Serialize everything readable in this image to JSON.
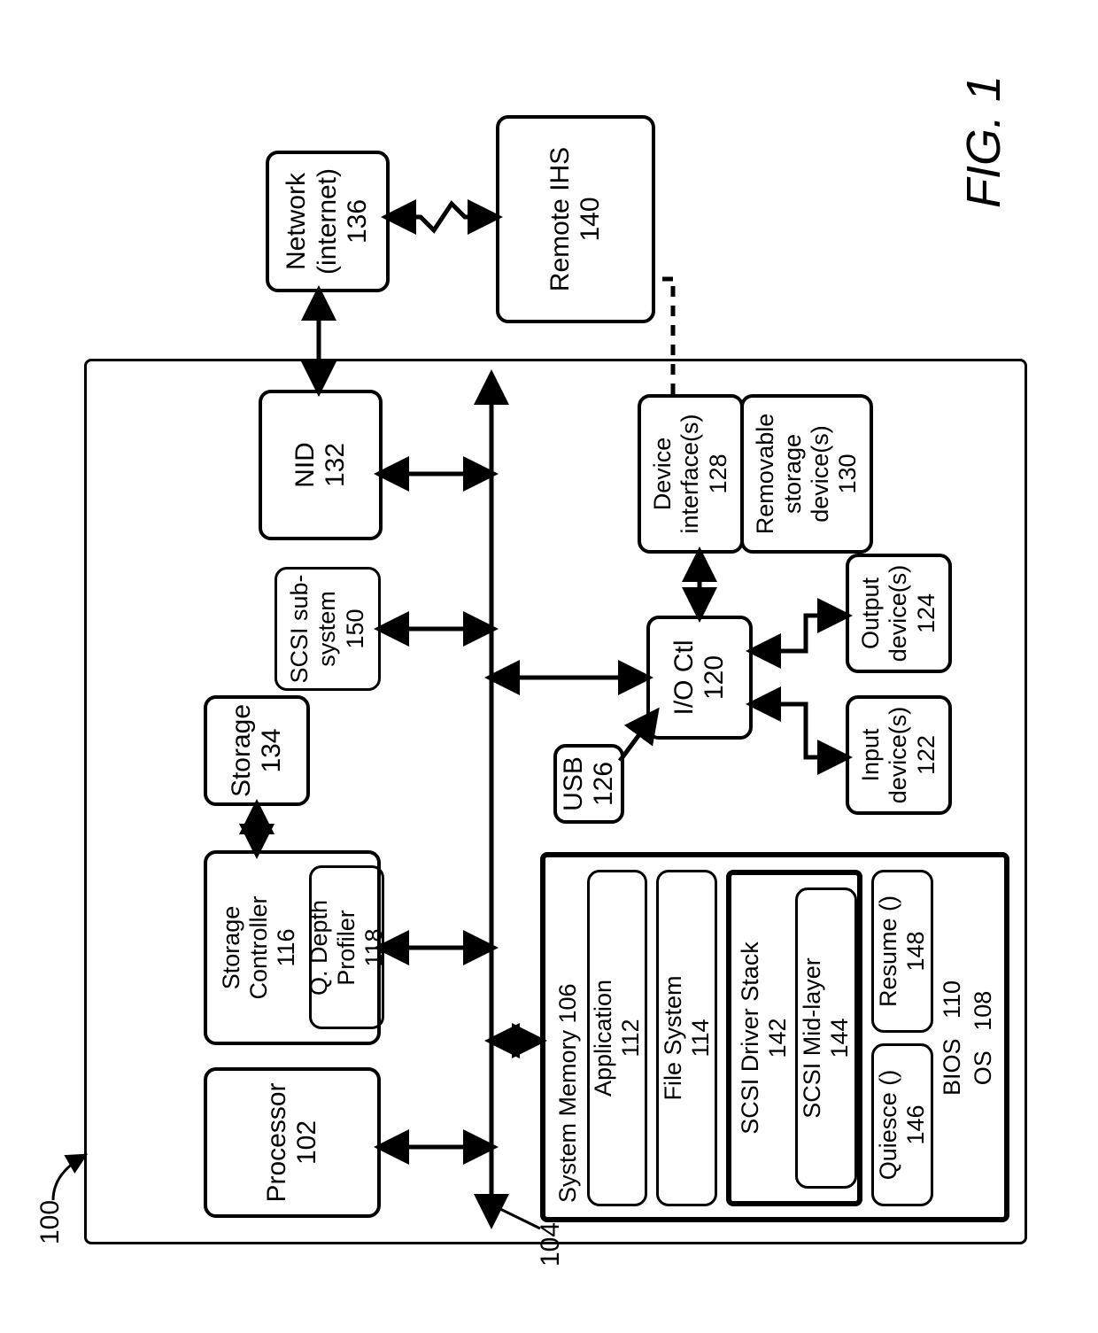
{
  "figure": "FIG. 1",
  "ref_main": "100",
  "ref_bus": "104",
  "processor": {
    "l1": "Processor",
    "l2": "102"
  },
  "storage_controller": {
    "l1": "Storage Controller",
    "l2": "116"
  },
  "q_depth_profiler": {
    "l1": "Q. Depth Profiler",
    "l2": "118"
  },
  "storage": {
    "l1": "Storage",
    "l2": "134"
  },
  "scsi_sub": {
    "l1": "SCSI sub-",
    "l2": "system",
    "l3": "150"
  },
  "nid": {
    "l1": "NID",
    "l2": "132"
  },
  "network": {
    "l1": "Network",
    "l2": "(internet)",
    "l3": "136"
  },
  "remote": {
    "l1": "Remote IHS",
    "l2": "140"
  },
  "sysmem": {
    "l1": "System Memory 106"
  },
  "application": {
    "l1": "Application",
    "l2": "112"
  },
  "file_system": {
    "l1": "File System",
    "l2": "114"
  },
  "scsi_stack": {
    "l1": "SCSI Driver Stack",
    "l2": "142"
  },
  "scsi_mid": {
    "l1": "SCSI Mid-layer",
    "l2": "144"
  },
  "quiesce": {
    "l1": "Quiesce ()",
    "l2": "146"
  },
  "resume": {
    "l1": "Resume ()",
    "l2": "148"
  },
  "bios": {
    "l1": "BIOS",
    "l2": "110"
  },
  "os": {
    "l1": "OS",
    "l2": "108"
  },
  "usb": {
    "l1": "USB",
    "l2": "126"
  },
  "ioctl": {
    "l1": "I/O Ctl",
    "l2": "120"
  },
  "input": {
    "l1": "Input",
    "l2": "device(s)",
    "l3": "122"
  },
  "output": {
    "l1": "Output",
    "l2": "device(s)",
    "l3": "124"
  },
  "device_if": {
    "l1": "Device",
    "l2": "interface(s)",
    "l3": "128"
  },
  "removable": {
    "l1": "Removable",
    "l2": "storage",
    "l3": "device(s)",
    "l4": "130"
  }
}
